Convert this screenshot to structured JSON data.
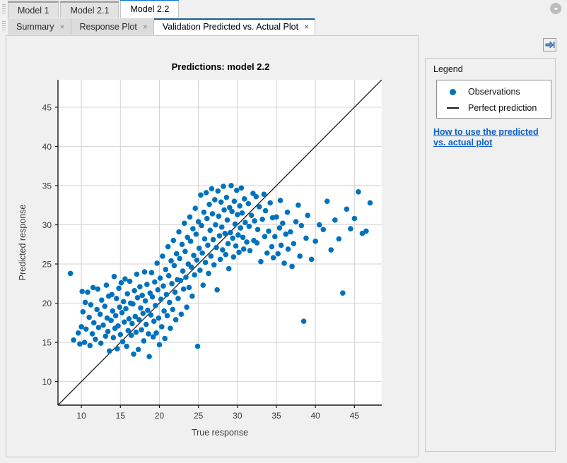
{
  "window": {
    "overflow_icon": "chevron-down-circle-icon"
  },
  "model_tabs": [
    {
      "label": "Model 1",
      "active": false
    },
    {
      "label": "Model 2.1",
      "active": false
    },
    {
      "label": "Model 2.2",
      "active": true
    }
  ],
  "document_tabs": [
    {
      "label": "Summary",
      "active": false,
      "close_glyph": "×"
    },
    {
      "label": "Response Plot",
      "active": false,
      "close_glyph": "×"
    },
    {
      "label": "Validation Predicted vs. Actual Plot",
      "active": true,
      "close_glyph": "×"
    }
  ],
  "sidebar": {
    "collapse_icon": "collapse-panel-right-icon",
    "legend_title": "Legend",
    "legend_items": [
      {
        "label": "Observations",
        "marker": "circle",
        "color": "#0072bd"
      },
      {
        "label": "Perfect prediction",
        "marker": "line",
        "color": "#1a1a1a"
      }
    ],
    "help_link": "How to use the predicted vs. actual plot"
  },
  "chart_data": {
    "type": "scatter",
    "title": "Predictions: model 2.2",
    "xlabel": "True response",
    "ylabel": "Predicted response",
    "xlim": [
      7.0,
      48.5
    ],
    "ylim": [
      7.0,
      48.5
    ],
    "xticks": [
      10,
      15,
      20,
      25,
      30,
      35,
      40,
      45
    ],
    "yticks": [
      10,
      15,
      20,
      25,
      30,
      35,
      40,
      45
    ],
    "grid": true,
    "legend_position": "right-panel",
    "marker_color": "#0072bd",
    "marker_size": 5,
    "reference_line": {
      "name": "Perfect prediction",
      "color": "#1a1a1a",
      "from": [
        7.0,
        7.0
      ],
      "to": [
        48.5,
        48.5
      ]
    },
    "series": [
      {
        "name": "Observations",
        "x": [
          8.6,
          9.0,
          9.6,
          9.8,
          10.0,
          10.1,
          10.2,
          10.4,
          10.5,
          10.6,
          10.8,
          11.0,
          11.1,
          11.2,
          11.4,
          11.5,
          11.6,
          11.8,
          12.0,
          12.1,
          12.2,
          12.4,
          12.5,
          12.6,
          12.8,
          13.0,
          13.1,
          13.2,
          13.3,
          13.4,
          13.5,
          13.6,
          13.8,
          13.9,
          14.0,
          14.1,
          14.2,
          14.3,
          14.4,
          14.5,
          14.6,
          14.7,
          14.8,
          14.9,
          15.0,
          15.1,
          15.2,
          15.3,
          15.4,
          15.5,
          15.6,
          15.7,
          15.8,
          15.9,
          16.0,
          16.1,
          16.2,
          16.3,
          16.4,
          16.5,
          16.6,
          16.7,
          16.8,
          16.9,
          17.0,
          17.1,
          17.2,
          17.3,
          17.4,
          17.5,
          17.6,
          17.7,
          17.8,
          17.9,
          18.0,
          18.1,
          18.2,
          18.3,
          18.4,
          18.5,
          18.6,
          18.7,
          18.8,
          18.9,
          19.0,
          19.1,
          19.2,
          19.3,
          19.4,
          19.5,
          19.6,
          19.7,
          19.8,
          19.9,
          20.0,
          20.1,
          20.2,
          20.3,
          20.4,
          20.5,
          20.6,
          20.7,
          20.8,
          20.9,
          21.0,
          21.1,
          21.2,
          21.3,
          21.4,
          21.5,
          21.6,
          21.7,
          21.8,
          21.9,
          22.0,
          22.1,
          22.2,
          22.3,
          22.4,
          22.5,
          22.6,
          22.7,
          22.8,
          22.9,
          23.0,
          23.1,
          23.2,
          23.3,
          23.4,
          23.5,
          23.6,
          23.7,
          23.8,
          23.9,
          24.0,
          24.1,
          24.2,
          24.3,
          24.4,
          24.5,
          24.6,
          24.7,
          24.8,
          24.9,
          25.0,
          25.1,
          25.2,
          25.3,
          25.4,
          25.5,
          25.6,
          25.7,
          25.8,
          25.9,
          26.0,
          26.1,
          26.2,
          26.3,
          26.4,
          26.5,
          26.6,
          26.7,
          26.8,
          26.9,
          27.0,
          27.1,
          27.2,
          27.3,
          27.4,
          27.5,
          27.6,
          27.7,
          27.8,
          27.9,
          28.0,
          28.1,
          28.2,
          28.3,
          28.4,
          28.5,
          28.6,
          28.7,
          28.8,
          28.9,
          29.0,
          29.1,
          29.2,
          29.3,
          29.4,
          29.5,
          29.6,
          29.7,
          29.8,
          29.9,
          30.0,
          30.1,
          30.2,
          30.3,
          30.4,
          30.5,
          30.6,
          30.7,
          30.8,
          30.9,
          31.0,
          31.2,
          31.4,
          31.5,
          31.6,
          31.8,
          32.0,
          32.1,
          32.2,
          32.4,
          32.5,
          32.6,
          32.8,
          33.0,
          33.2,
          33.4,
          33.5,
          33.6,
          33.8,
          34.0,
          34.2,
          34.4,
          34.5,
          34.6,
          34.8,
          35.0,
          35.2,
          35.4,
          35.5,
          35.6,
          35.8,
          36.0,
          36.2,
          36.4,
          36.5,
          36.8,
          37.0,
          37.2,
          37.5,
          37.8,
          38.0,
          38.2,
          38.5,
          38.8,
          39.0,
          39.5,
          40.0,
          40.5,
          41.0,
          41.5,
          42.0,
          42.5,
          43.0,
          43.5,
          44.0,
          44.5,
          45.0,
          45.5,
          46.0,
          46.5,
          47.0
        ],
        "y": [
          23.8,
          15.3,
          16.2,
          14.8,
          17.0,
          21.5,
          18.9,
          15.0,
          20.1,
          16.7,
          21.4,
          18.2,
          14.6,
          19.8,
          16.1,
          22.0,
          17.5,
          15.4,
          19.2,
          21.8,
          16.9,
          18.6,
          14.9,
          20.4,
          17.2,
          19.6,
          15.8,
          22.3,
          18.1,
          16.4,
          20.9,
          13.9,
          17.8,
          21.1,
          19.0,
          15.6,
          23.4,
          16.8,
          18.4,
          20.6,
          14.2,
          17.1,
          21.9,
          19.5,
          16.0,
          22.6,
          18.8,
          15.1,
          20.2,
          17.6,
          23.1,
          19.3,
          14.5,
          21.2,
          16.5,
          18.0,
          22.8,
          20.0,
          15.9,
          17.4,
          19.9,
          13.5,
          21.6,
          18.3,
          16.3,
          23.7,
          20.7,
          14.1,
          17.9,
          22.1,
          19.4,
          16.6,
          21.0,
          18.7,
          15.2,
          24.0,
          20.3,
          17.3,
          22.4,
          19.1,
          16.1,
          13.2,
          21.3,
          18.5,
          23.9,
          20.8,
          15.7,
          17.7,
          22.7,
          19.7,
          16.2,
          25.1,
          21.7,
          18.1,
          14.7,
          23.2,
          20.5,
          17.0,
          26.0,
          22.2,
          19.0,
          15.5,
          24.3,
          21.1,
          18.4,
          27.2,
          23.5,
          20.1,
          16.8,
          25.4,
          22.5,
          19.2,
          28.0,
          24.8,
          21.4,
          17.9,
          26.3,
          23.0,
          20.6,
          29.1,
          25.7,
          22.9,
          18.6,
          27.5,
          24.1,
          21.8,
          30.2,
          26.6,
          23.3,
          19.5,
          28.4,
          25.0,
          22.0,
          31.0,
          27.9,
          24.6,
          20.9,
          29.5,
          26.1,
          23.6,
          32.1,
          28.8,
          25.5,
          14.5,
          30.4,
          27.0,
          24.2,
          33.8,
          29.9,
          26.4,
          22.3,
          31.6,
          28.2,
          25.2,
          34.1,
          30.8,
          27.4,
          23.8,
          32.6,
          29.3,
          26.0,
          34.6,
          31.4,
          28.1,
          24.9,
          33.2,
          30.0,
          27.1,
          21.7,
          34.3,
          31.1,
          28.6,
          25.6,
          32.9,
          29.7,
          26.8,
          34.9,
          31.9,
          28.9,
          26.2,
          33.5,
          30.6,
          27.6,
          24.4,
          32.2,
          29.0,
          35.0,
          31.7,
          28.3,
          25.9,
          33.0,
          30.1,
          27.3,
          34.4,
          31.3,
          28.7,
          26.5,
          32.4,
          29.6,
          34.7,
          31.5,
          28.4,
          26.9,
          33.3,
          30.3,
          27.8,
          32.7,
          29.8,
          26.7,
          31.2,
          34.0,
          28.0,
          30.5,
          33.6,
          27.7,
          29.4,
          32.3,
          25.3,
          30.7,
          33.9,
          28.5,
          31.8,
          26.4,
          29.2,
          32.8,
          27.2,
          30.9,
          25.8,
          28.5,
          31.0,
          26.3,
          29.6,
          33.1,
          27.4,
          30.2,
          25.1,
          28.8,
          31.6,
          26.9,
          29.1,
          24.7,
          27.6,
          30.4,
          32.5,
          26.0,
          29.9,
          17.7,
          28.3,
          31.2,
          25.6,
          27.9,
          30.0,
          29.4,
          33.0,
          26.8,
          30.6,
          28.2,
          21.3,
          32.0,
          29.5,
          30.8,
          34.2,
          28.9,
          29.2,
          32.8
        ]
      }
    ]
  }
}
